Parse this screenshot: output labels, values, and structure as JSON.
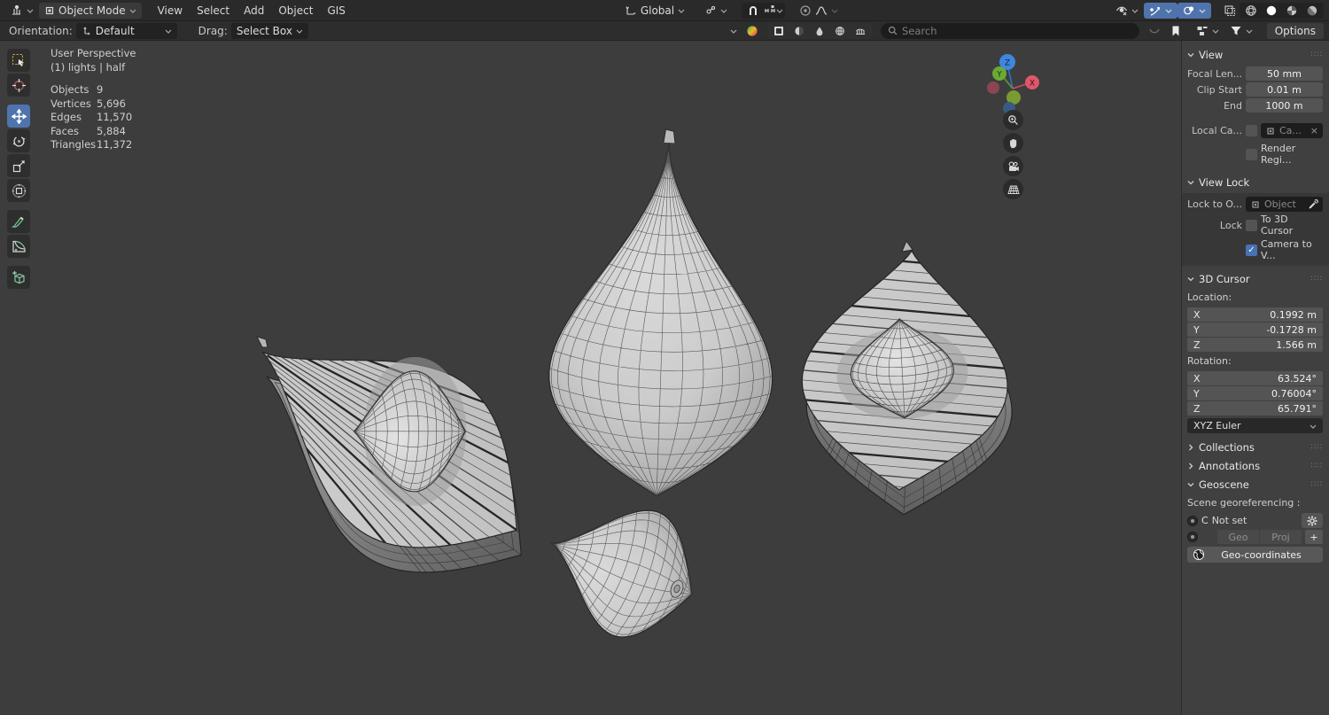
{
  "header": {
    "mode_label": "Object Mode",
    "menus": [
      "View",
      "Select",
      "Add",
      "Object",
      "GIS"
    ],
    "orientation_value": "Global",
    "options_label": "Options"
  },
  "toolbar2": {
    "orientation_label": "Orientation:",
    "orientation_value": "Default",
    "drag_label": "Drag:",
    "drag_value": "Select Box",
    "search_placeholder": "Search"
  },
  "viewport": {
    "view_label": "User Perspective",
    "scene_label": "(1) lights | half",
    "stats": [
      {
        "label": "Objects",
        "value": "9"
      },
      {
        "label": "Vertices",
        "value": "5,696"
      },
      {
        "label": "Edges",
        "value": "11,570"
      },
      {
        "label": "Faces",
        "value": "5,884"
      },
      {
        "label": "Triangles",
        "value": "11,372"
      }
    ],
    "gizmo": {
      "x": "X",
      "y": "Y",
      "z": "Z"
    }
  },
  "sidebar": {
    "view_panel": {
      "title": "View",
      "focal_label": "Focal Len...",
      "focal_value": "50 mm",
      "clip_start_label": "Clip Start",
      "clip_start_value": "0.01 m",
      "clip_end_label": "End",
      "clip_end_value": "1000 m",
      "local_camera_label": "Local Ca...",
      "local_camera_value": "Ca...",
      "render_region_label": "Render Regi..."
    },
    "view_lock": {
      "title": "View Lock",
      "lock_to_label": "Lock to O...",
      "lock_to_placeholder": "Object",
      "lock_label": "Lock",
      "to_3d_cursor": "To 3D Cursor",
      "camera_to_view": "Camera to V..."
    },
    "cursor_panel": {
      "title": "3D Cursor",
      "location_label": "Location:",
      "location": [
        {
          "axis": "X",
          "value": "0.1992 m"
        },
        {
          "axis": "Y",
          "value": "-0.1728 m"
        },
        {
          "axis": "Z",
          "value": "1.566 m"
        }
      ],
      "rotation_label": "Rotation:",
      "rotation": [
        {
          "axis": "X",
          "value": "63.524°"
        },
        {
          "axis": "Y",
          "value": "0.76004°"
        },
        {
          "axis": "Z",
          "value": "65.791°"
        }
      ],
      "euler": "XYZ Euler"
    },
    "collections_title": "Collections",
    "annotations_title": "Annotations",
    "geoscene": {
      "title": "Geoscene",
      "georef_label": "Scene georeferencing :",
      "crs_letter": "C",
      "crs_value": "Not set",
      "geo_label": "Geo",
      "proj_label": "Proj",
      "plus_label": "+",
      "geo_coords_label": "Geo-coordinates"
    }
  },
  "colors": {
    "accent_blue": "#4f74ad",
    "checkbox_blue": "#4772b3",
    "viewport_bg": "#3d3d3d",
    "header_bg": "#2a2a2a",
    "sidebar_bg": "#404040",
    "mesh_fill": "#c9c9c9",
    "wire_stroke": "#3a3a3a"
  }
}
